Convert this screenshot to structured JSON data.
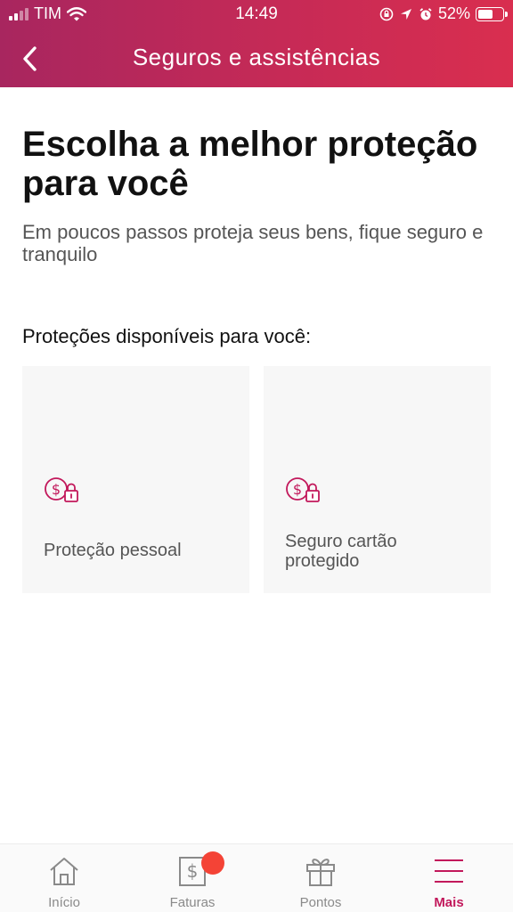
{
  "status_bar": {
    "carrier": "TIM",
    "time": "14:49",
    "battery": "52%",
    "battery_level": 0.52
  },
  "header": {
    "title": "Seguros e assistências",
    "back_icon": "chevron-left-icon",
    "background_colors": [
      "#a8265f",
      "#d92e4f"
    ]
  },
  "main": {
    "title": "Escolha a melhor proteção para você",
    "subtitle": "Em poucos passos proteja seus bens, fique seguro e tranquilo",
    "section_label": "Proteções disponíveis para você:",
    "cards": [
      {
        "label": "Proteção pessoal",
        "icon": "money-lock-icon"
      },
      {
        "label": "Seguro cartão protegido",
        "icon": "money-lock-icon"
      }
    ]
  },
  "tabbar": {
    "items": [
      {
        "label": "Início",
        "icon": "home-icon"
      },
      {
        "label": "Faturas",
        "icon": "bill-icon",
        "has_badge": true
      },
      {
        "label": "Pontos",
        "icon": "gift-icon"
      },
      {
        "label": "Mais",
        "icon": "menu-icon",
        "active": true
      }
    ],
    "accent_color": "#c2185b",
    "badge_color": "#f44336"
  }
}
